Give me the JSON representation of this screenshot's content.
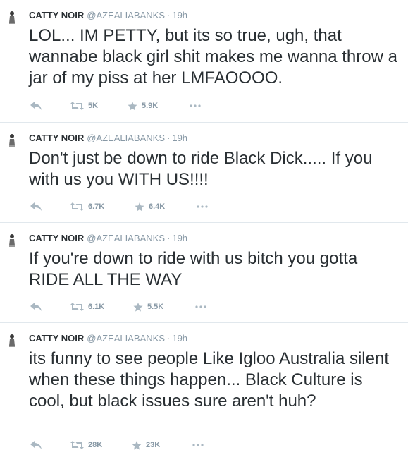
{
  "colors": {
    "text": "#292f33",
    "muted": "#8899a6",
    "divider": "#e1e8ed",
    "icon": "#aab8c2"
  },
  "icons": {
    "reply": "reply-icon",
    "retweet": "retweet-icon",
    "favorite": "star-icon",
    "more": "more-icon",
    "avatar": "avatar"
  },
  "tweets": [
    {
      "fullname": "CATTY NOIR",
      "username": "@AZEALIABANKS",
      "separator": "·",
      "time": "19h",
      "text": "LOL... IM PETTY, but its so true, ugh, that wannabe black girl shit makes me wanna throw a jar of my piss at her LMFAOOOO.",
      "retweets": "5K",
      "favorites": "5.9K"
    },
    {
      "fullname": "CATTY NOIR",
      "username": "@AZEALIABANKS",
      "separator": "·",
      "time": "19h",
      "text": "Don't just be down to ride Black Dick..... If you with us you WITH US!!!!",
      "retweets": "6.7K",
      "favorites": "6.4K"
    },
    {
      "fullname": "CATTY NOIR",
      "username": "@AZEALIABANKS",
      "separator": "·",
      "time": "19h",
      "text": "If you're down to ride with us bitch you gotta RIDE ALL THE WAY",
      "retweets": "6.1K",
      "favorites": "5.5K"
    },
    {
      "fullname": "CATTY NOIR",
      "username": "@AZEALIABANKS",
      "separator": "·",
      "time": "19h",
      "text": "its funny to see people Like Igloo Australia silent when these things happen... Black Culture is cool, but black issues sure aren't huh?",
      "retweets": "28K",
      "favorites": "23K"
    }
  ]
}
